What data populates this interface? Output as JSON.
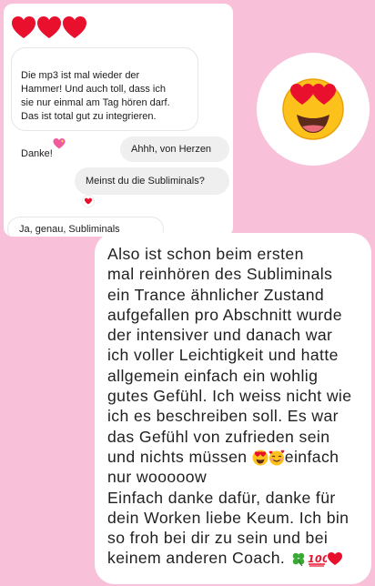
{
  "chat": {
    "messages": [
      {
        "text": "Die mp3 ist mal wieder der\nHammer! Und auch toll, dass ich\nsie nur einmal am Tag hören darf.\nDas ist total gut zu integrieren.\nDanke!"
      },
      {
        "text": "Ahhh, von Herzen"
      },
      {
        "text": "Meinst du die Subliminals?"
      },
      {
        "text": "Ja, genau, Subliminals"
      }
    ]
  },
  "testimonial": {
    "lines": [
      "Also ist schon beim ersten",
      "mal reinhören des Subliminals",
      "ein Trance ähnlicher Zustand",
      "aufgefallen pro Abschnitt wurde",
      "der intensiver und danach war",
      "ich voller Leichtigkeit und hatte",
      "allgemein einfach ein wohlig",
      "gutes Gefühl. Ich weiss nicht wie",
      "ich es beschreiben soll. Es war",
      "das Gefühl von zufrieden sein",
      "und nichts müssen ",
      "einfach",
      "nur wooooow",
      "Einfach danke dafür, danke für",
      "dein Worken liebe Keum. Ich bin",
      "so froh bei dir zu sein und bei",
      "keinem anderen Coach. "
    ]
  },
  "icons": {
    "top_hearts": "red-heart-icon",
    "sparkle_heart": "sparkling-heart-icon",
    "reaction": "red-heart-icon",
    "big_emoji": "heart-eyes-face-icon",
    "inline": [
      "heart-eyes-face-icon",
      "smiling-face-with-hearts-icon",
      "four-leaf-clover-icon",
      "hundred-points-icon",
      "red-heart-icon"
    ]
  },
  "colors": {
    "background": "#f8c1d9",
    "bubble_out": "#efefef",
    "heart": "#e8102c"
  }
}
